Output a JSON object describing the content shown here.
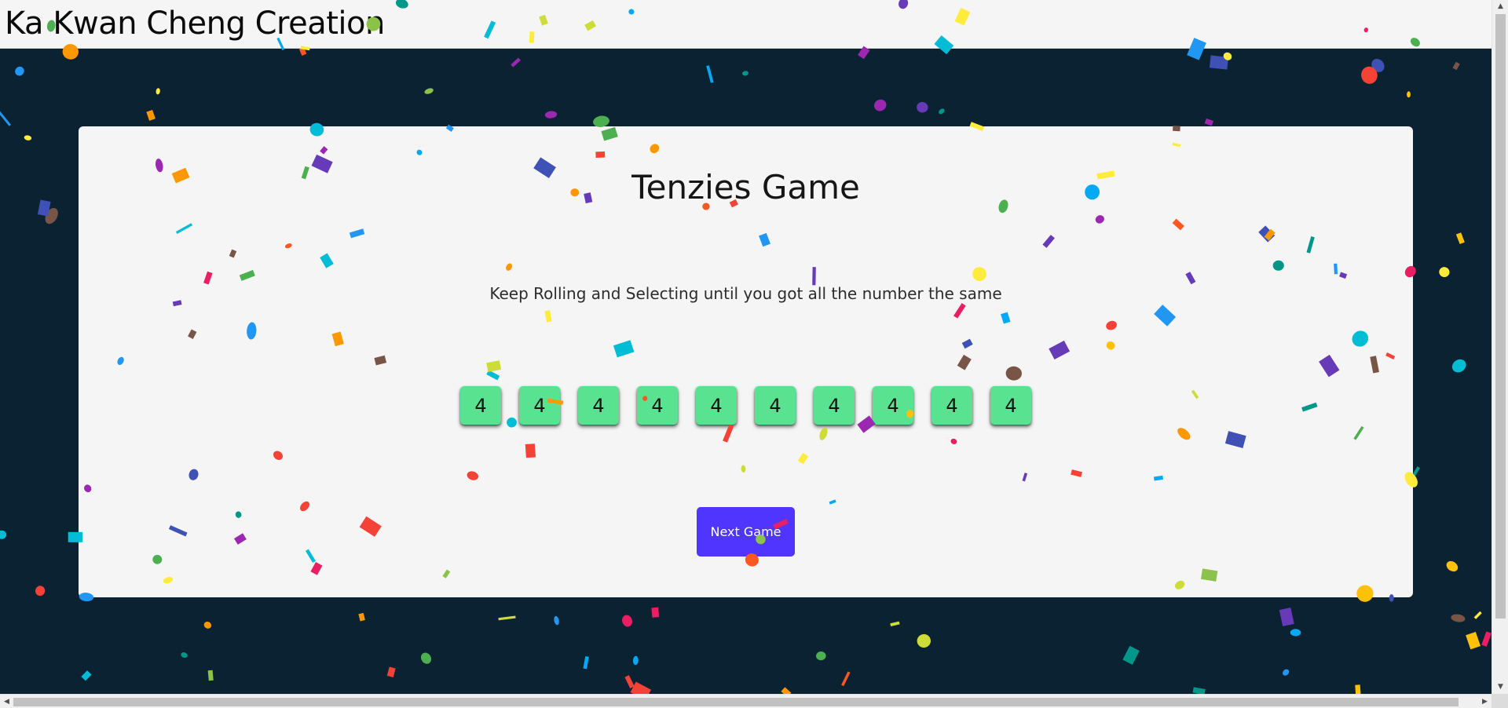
{
  "header": {
    "site_title": "Ka Kwan Cheng Creation"
  },
  "game": {
    "title": "Tenzies Game",
    "instructions": "Keep Rolling and Selecting until you got all the number the same",
    "dice": [
      "4",
      "4",
      "4",
      "4",
      "4",
      "4",
      "4",
      "4",
      "4",
      "4"
    ],
    "button_label": "Next Game",
    "status": "won"
  },
  "colors": {
    "page_background": "#0b2233",
    "card_background": "#f5f5f5",
    "die_color": "#59e391",
    "button_color": "#5035ff"
  },
  "confetti": {
    "palette": [
      "#f44336",
      "#e91e63",
      "#9c27b0",
      "#673ab7",
      "#3f51b5",
      "#2196f3",
      "#03a9f4",
      "#00bcd4",
      "#009688",
      "#4caf50",
      "#8bc34a",
      "#cddc39",
      "#ffeb3b",
      "#ffc107",
      "#ff9800",
      "#ff5722",
      "#795548"
    ]
  },
  "scrollbars": {
    "up_arrow": "▲",
    "down_arrow": "▼",
    "left_arrow": "◀",
    "right_arrow": "▶"
  }
}
